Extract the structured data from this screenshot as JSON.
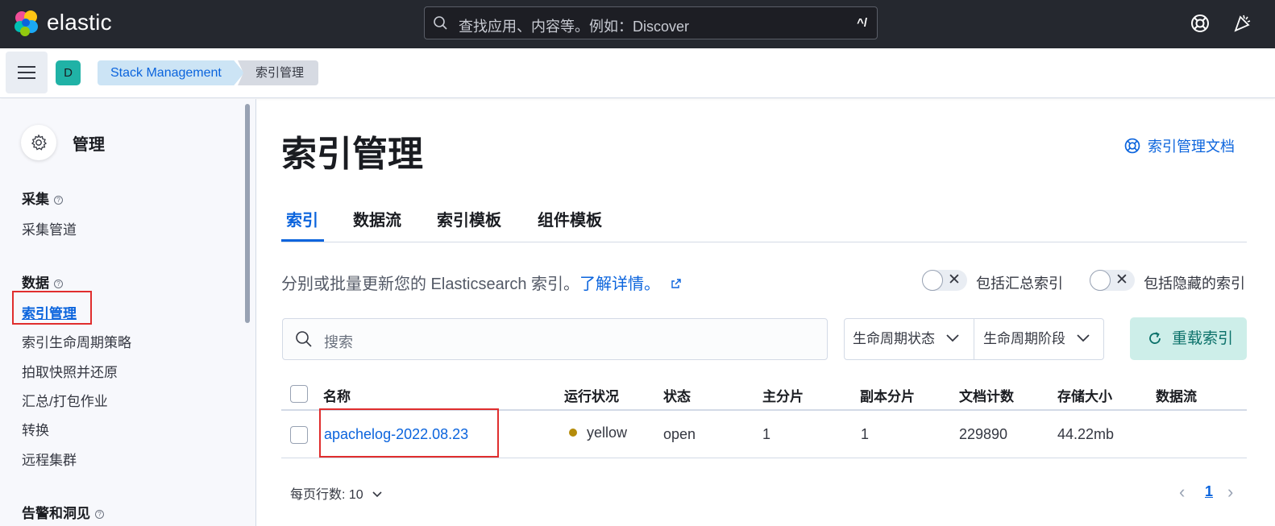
{
  "header": {
    "brand": "elastic",
    "search_placeholder": "查找应用、内容等。例如：Discover",
    "search_shortcut": "^/"
  },
  "subheader": {
    "space_initial": "D",
    "breadcrumbs": [
      "Stack Management",
      "索引管理"
    ]
  },
  "sidebar": {
    "title": "管理",
    "groups": [
      {
        "label": "采集",
        "items": [
          "采集管道"
        ]
      },
      {
        "label": "数据",
        "items": [
          "索引管理",
          "索引生命周期策略",
          "拍取快照并还原",
          "汇总/打包作业",
          "转换",
          "远程集群"
        ]
      },
      {
        "label": "告警和洞见",
        "items": []
      }
    ],
    "active_item": "索引管理"
  },
  "main": {
    "title": "索引管理",
    "doc_link": "索引管理文档",
    "tabs": [
      "索引",
      "数据流",
      "索引模板",
      "组件模板"
    ],
    "selected_tab": "索引",
    "description": "分别或批量更新您的 Elasticsearch 索引。",
    "learn_more": "了解详情。",
    "toggles": [
      {
        "label": "包括汇总索引",
        "on": false
      },
      {
        "label": "包括隐藏的索引",
        "on": false
      }
    ],
    "search_placeholder": "搜索",
    "filters": [
      "生命周期状态",
      "生命周期阶段"
    ],
    "reload_label": "重载索引",
    "columns": [
      "名称",
      "运行状况",
      "状态",
      "主分片",
      "副本分片",
      "文档计数",
      "存储大小",
      "数据流"
    ],
    "rows": [
      {
        "name": "apachelog-2022.08.23",
        "health": "yellow",
        "status": "open",
        "primary": "1",
        "replica": "1",
        "docs": "229890",
        "size": "44.22mb",
        "datastream": ""
      }
    ],
    "rows_per_page": "每页行数: 10",
    "current_page": "1"
  },
  "colors": {
    "accent": "#0b64dd",
    "header_bg": "#25282f",
    "health_yellow": "#b58c0a"
  }
}
